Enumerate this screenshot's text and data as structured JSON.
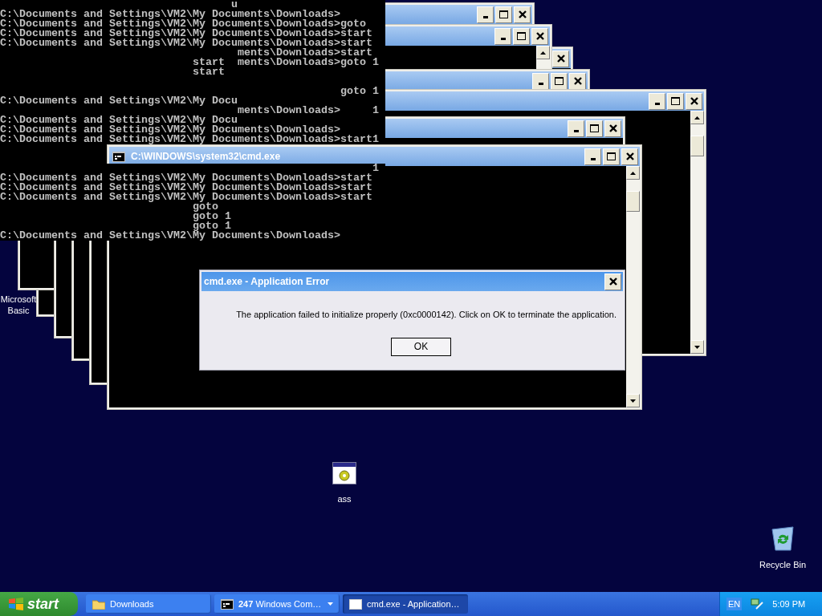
{
  "console": {
    "lines_upper": [
      "                                    u",
      "C:\\Documents and Settings\\VM2\\My Documents\\Downloads>",
      "C:\\Documents and Settings\\VM2\\My Documents\\Downloads>goto",
      "C:\\Documents and Settings\\VM2\\My Documents\\Downloads>start",
      "C:\\Documents and Settings\\VM2\\My Documents\\Downloads>start",
      "                                     ments\\Downloads>start",
      "                              start  ments\\Downloads>goto 1",
      "                              start",
      "\n                                                     goto 1",
      "C:\\Documents and Settings\\VM2\\My Docu",
      "                                     ments\\Downloads>     1",
      "C:\\Documents and Settings\\VM2\\My Docu",
      "C:\\Documents and Settings\\VM2\\My Documents\\Downloads>",
      "C:\\Documents and Settings\\VM2\\My Documents\\Downloads>start1"
    ],
    "lines_lower": [
      "                                                          1",
      "C:\\Documents and Settings\\VM2\\My Documents\\Downloads>start",
      "C:\\Documents and Settings\\VM2\\My Documents\\Downloads>start",
      "C:\\Documents and Settings\\VM2\\My Documents\\Downloads>start",
      "                              goto",
      "                              goto 1",
      "                              goto 1",
      "C:\\Documents and Settings\\VM2\\My Documents\\Downloads>"
    ]
  },
  "main_window": {
    "title": "C:\\WINDOWS\\system32\\cmd.exe"
  },
  "desktop_icons": [
    {
      "kind": "partial",
      "label": "Microsoft Basic"
    },
    {
      "kind": "program",
      "label": "ass"
    },
    {
      "kind": "recycle-bin",
      "label": "Recycle Bin"
    }
  ],
  "dialog": {
    "title": "cmd.exe - Application Error",
    "message": "The application failed to initialize properly (0xc0000142). Click on OK to terminate the application.",
    "button": "OK"
  },
  "taskbar": {
    "start": "start",
    "tasks": [
      {
        "kind": "folder",
        "label": "Downloads",
        "selected": false
      },
      {
        "kind": "console-group",
        "label": "**247** Windows Com…",
        "selected": false
      },
      {
        "kind": "window",
        "label": "cmd.exe - Application…",
        "selected": true
      }
    ],
    "language": "EN",
    "clock": "5:09 PM"
  }
}
